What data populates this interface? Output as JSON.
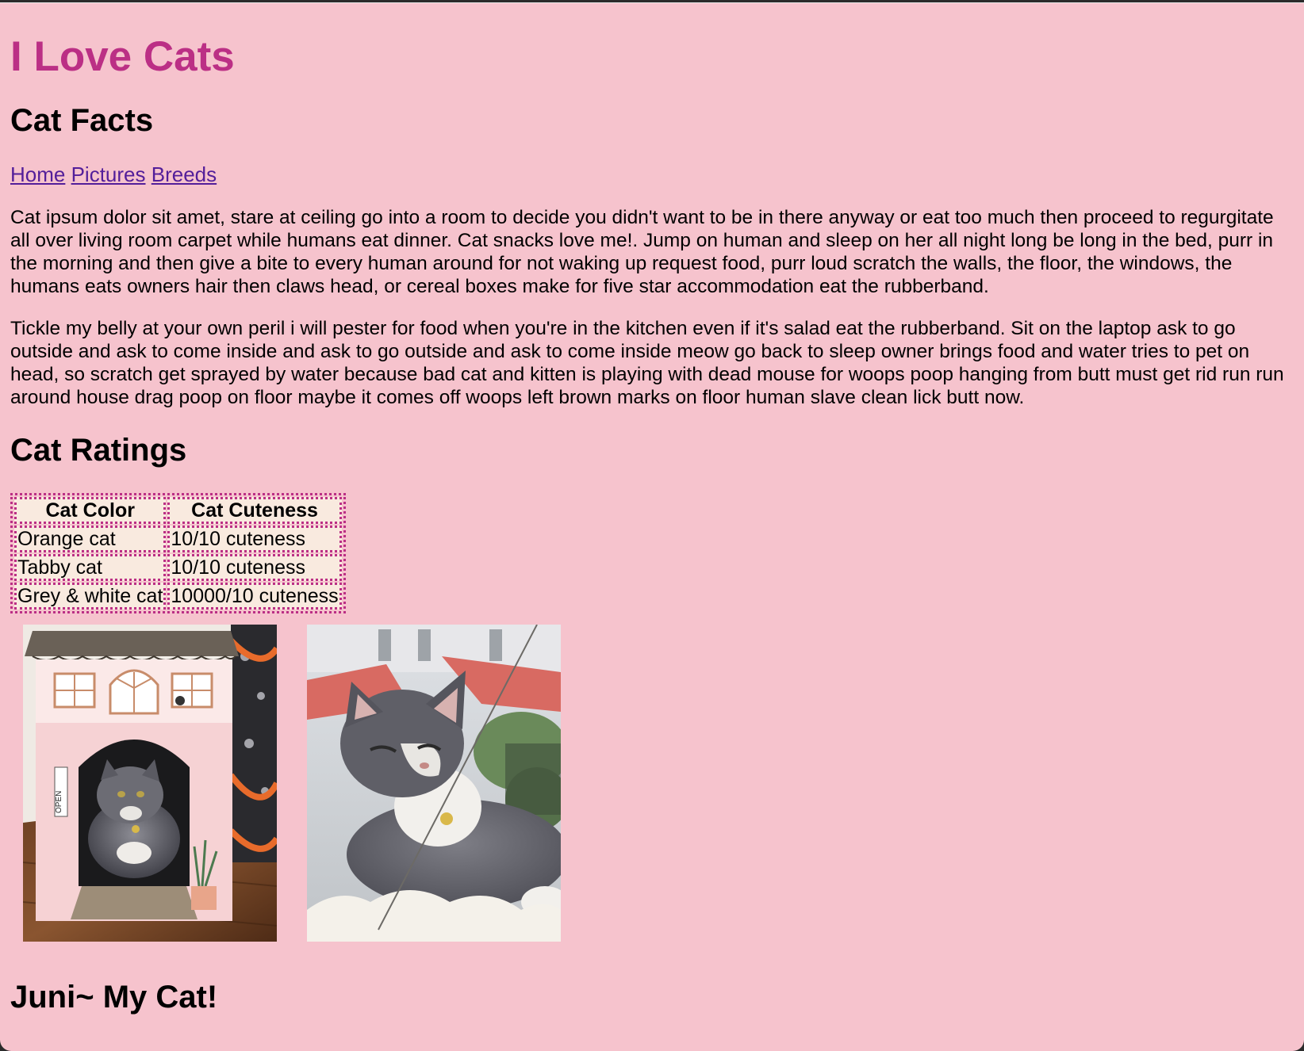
{
  "title": "I Love Cats",
  "facts_heading": "Cat Facts",
  "nav": {
    "links": [
      "Home",
      "Pictures",
      "Breeds"
    ]
  },
  "paragraphs": [
    "Cat ipsum dolor sit amet, stare at ceiling go into a room to decide you didn't want to be in there anyway or eat too much then proceed to regurgitate all over living room carpet while humans eat dinner. Cat snacks love me!. Jump on human and sleep on her all night long be long in the bed, purr in the morning and then give a bite to every human around for not waking up request food, purr loud scratch the walls, the floor, the windows, the humans eats owners hair then claws head, or cereal boxes make for five star accommodation eat the rubberband.",
    "Tickle my belly at your own peril i will pester for food when you're in the kitchen even if it's salad eat the rubberband. Sit on the laptop ask to go outside and ask to come inside and ask to go outside and ask to come inside meow go back to sleep owner brings food and water tries to pet on head, so scratch get sprayed by water because bad cat and kitten is playing with dead mouse for woops poop hanging from butt must get rid run run around house drag poop on floor maybe it comes off woops left brown marks on floor human slave clean lick butt now."
  ],
  "ratings_heading": "Cat Ratings",
  "table": {
    "headers": [
      "Cat Color",
      "Cat Cuteness"
    ],
    "rows": [
      [
        "Orange cat",
        "10/10 cuteness"
      ],
      [
        "Tabby cat",
        "10/10 cuteness"
      ],
      [
        "Grey & white cat",
        "10000/10 cuteness"
      ]
    ]
  },
  "photo_box_sign": "OPEN",
  "juni_heading": "Juni~ My Cat!",
  "colors": {
    "background": "#f6c3cd",
    "title": "#bb2f85",
    "link": "#531e9a",
    "table_border": "#bb2f85",
    "table_cell": "#f9eadf"
  }
}
